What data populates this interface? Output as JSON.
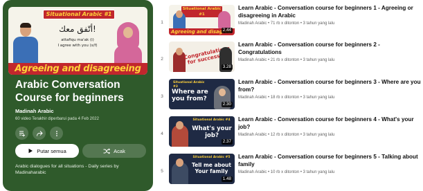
{
  "playlist": {
    "thumbnail": {
      "header": "Situational Arabic #1",
      "arabic": "أتّفق معك!",
      "translit": "attafiqu ma'ak (i)",
      "translation": "I agree with you (s/f)",
      "banner": "Agreeing and disagreeing"
    },
    "title": "Arabic Conversation Course for beginners",
    "channel": "Madinah Arabic",
    "video_count": "60 video",
    "updated": "Terakhir diperbarui pada 4 Feb 2022",
    "buttons": {
      "play_all": "Putar semua",
      "shuffle": "Acak"
    },
    "description": "Arabic dialogues for all situations - Daily series by Madinaharabic"
  },
  "videos": [
    {
      "index": "1",
      "title": "Learn Arabic - Conversation course for beginners 1 - Agreeing or disagreeing in Arabic",
      "meta": "Madinah Arabic • 71 rb x ditonton • 3 tahun yang lalu",
      "duration": "2.44",
      "thumb_top": "Situational Arabic #1",
      "thumb_bottom": "Agreeing and disagree"
    },
    {
      "index": "2",
      "title": "Learn Arabic - Conversation course for beginners 2 - Congratulations",
      "meta": "Madinah Arabic • 21 rb x ditonton • 3 tahun yang lalu",
      "duration": "3.28",
      "thumb_top": "",
      "thumb_bottom": "Congratulations for success"
    },
    {
      "index": "3",
      "title": "Learn Arabic - Conversation course for beginners 3 - Where are you from?",
      "meta": "Madinah Arabic • 18 rb x ditonton • 3 tahun yang lalu",
      "duration": "2.30",
      "thumb_top": "Situational Arabic #3",
      "thumb_bottom": "Where are you from?"
    },
    {
      "index": "4",
      "title": "Learn Arabic - Conversation course for beginners 4 - What's your job?",
      "meta": "Madinah Arabic • 12 rb x ditonton • 3 tahun yang lalu",
      "duration": "2.37",
      "thumb_top": "Situational Arabic #4",
      "thumb_bottom": "What's your job?"
    },
    {
      "index": "5",
      "title": "Learn Arabic - Conversation course for beginners 5 - Talking about family",
      "meta": "Madinah Arabic • 10 rb x ditonton • 3 tahun yang lalu",
      "duration": "1.48",
      "thumb_top": "Situational Arabic #5",
      "thumb_bottom": "Tell me about Your family"
    }
  ],
  "colors": {
    "panel_bg": "#2f5a2b",
    "brand_red": "#c1272d",
    "brand_yellow": "#ffd23a",
    "navy": "#1f2a44"
  },
  "icons": {
    "save": "add-to-queue-icon",
    "share": "share-icon",
    "more": "more-vert-icon",
    "play": "play-icon",
    "shuffle": "shuffle-icon"
  }
}
